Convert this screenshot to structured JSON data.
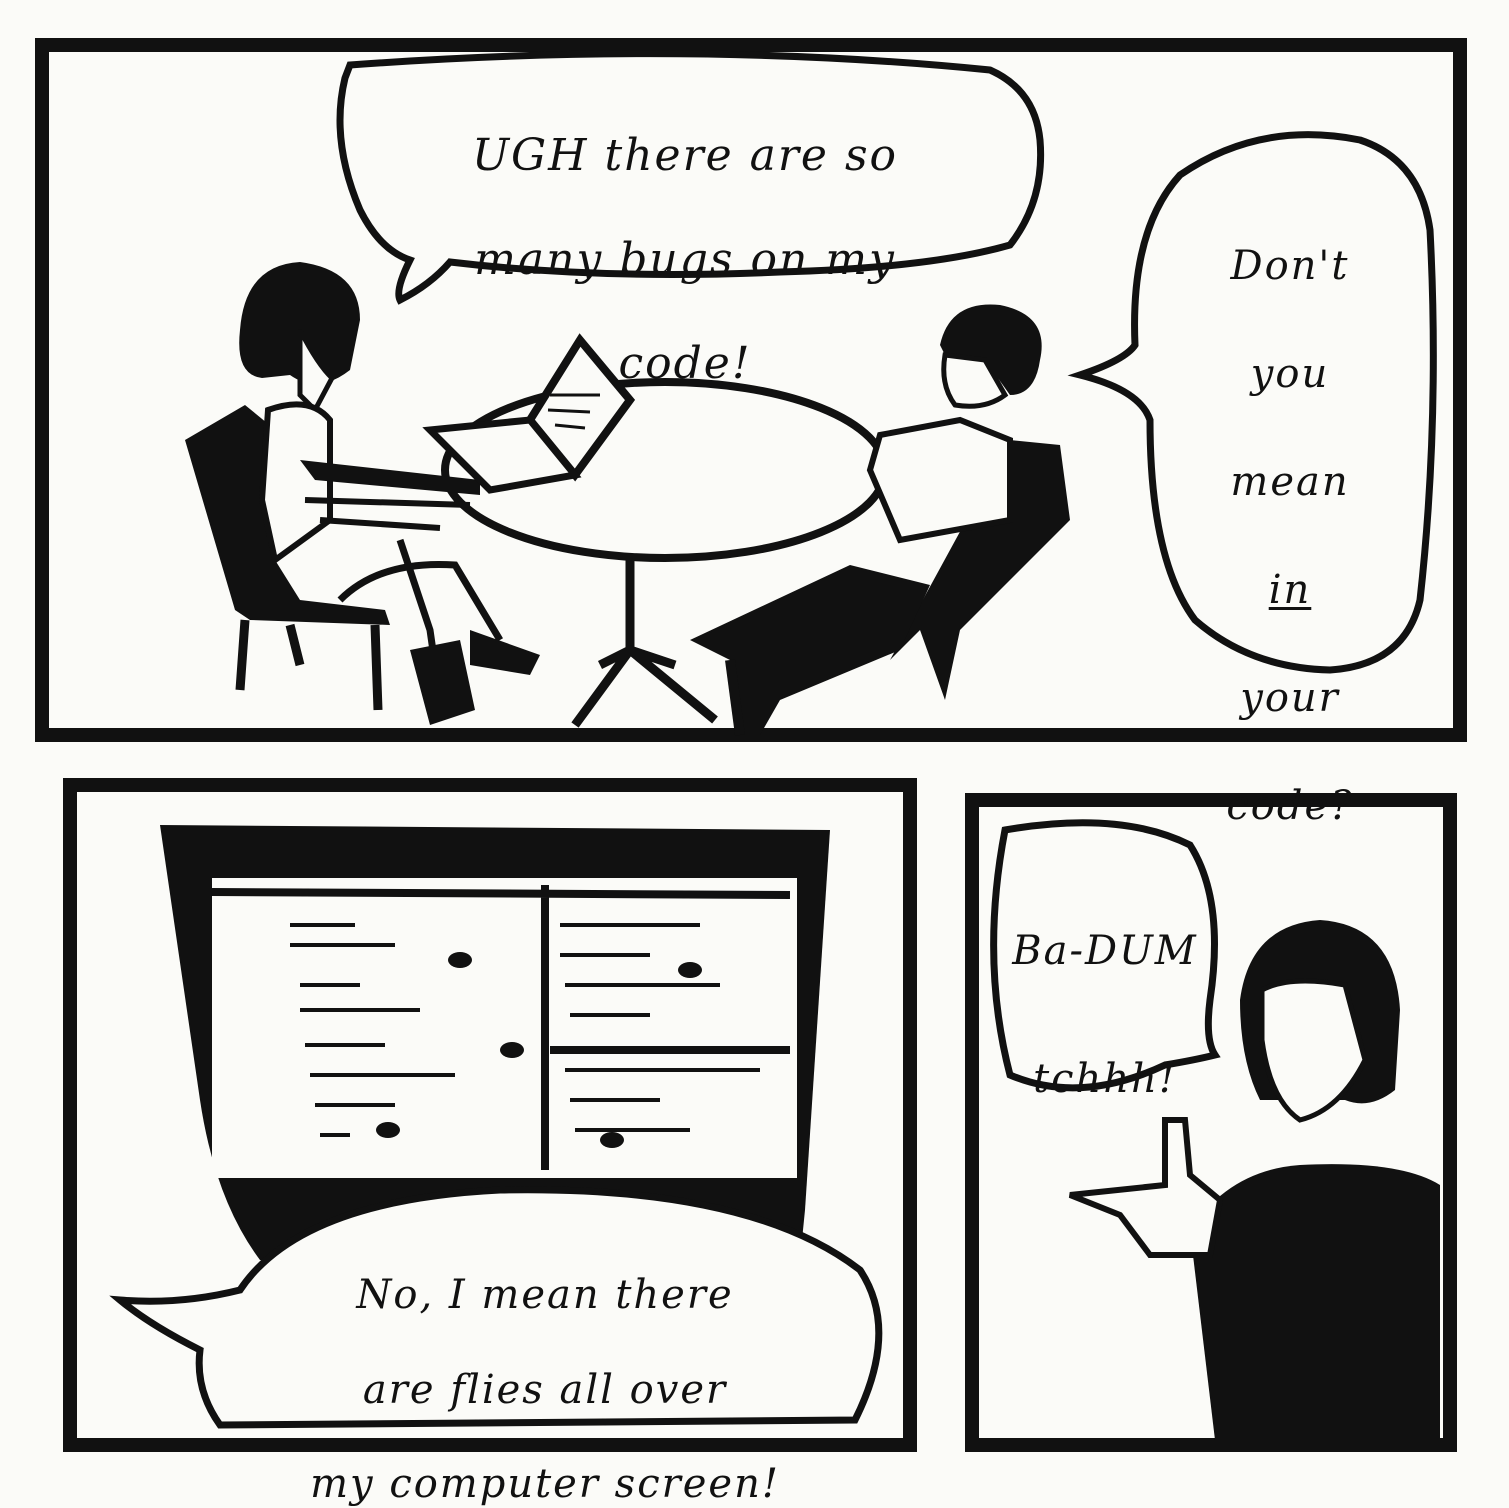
{
  "palette": {
    "ink": "#111111",
    "paper": "#fbfbf8"
  },
  "panels": [
    {
      "bubbles": [
        {
          "lines": [
            "UGH there are so",
            "many bugs on my",
            "code!"
          ]
        },
        {
          "lines": [
            "Don't",
            "you",
            "mean",
            "in",
            "your",
            "code?"
          ],
          "underlined_word": "in"
        }
      ]
    },
    {
      "bubbles": [
        {
          "lines": [
            "No, I mean there",
            "are flies all over",
            "my computer screen!"
          ]
        }
      ]
    },
    {
      "bubbles": [
        {
          "lines": [
            "Ba-DUM",
            "tchhh!"
          ]
        }
      ]
    }
  ]
}
